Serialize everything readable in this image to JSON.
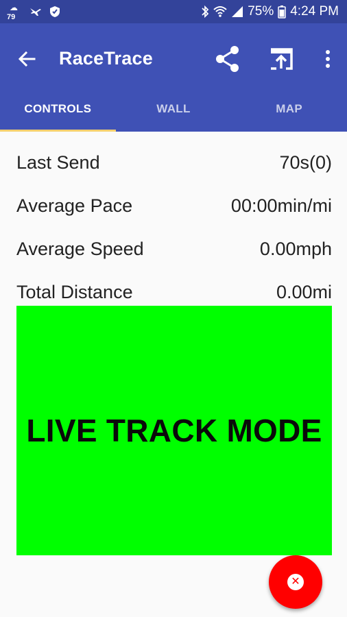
{
  "status_bar": {
    "temperature": "79",
    "battery": "75%",
    "time": "4:24 PM"
  },
  "toolbar": {
    "title": "RaceTrace",
    "icons": [
      "back-arrow-icon",
      "share-icon",
      "upload-icon",
      "more-vert-icon"
    ]
  },
  "tabs": [
    {
      "label": "CONTROLS",
      "active": true
    },
    {
      "label": "WALL",
      "active": false
    },
    {
      "label": "MAP",
      "active": false
    }
  ],
  "stats": [
    {
      "label": "Last Send",
      "value": "70s(0)"
    },
    {
      "label": "Average Pace",
      "value": "00:00min/mi"
    },
    {
      "label": "Average Speed",
      "value": "0.00mph"
    },
    {
      "label": "Total Distance",
      "value": "0.00mi"
    }
  ],
  "live_mode": {
    "text": "LIVE TRACK MODE",
    "color": "#00ff00"
  },
  "fab": {
    "icon": "close-icon",
    "color": "#ff0000"
  },
  "colors": {
    "status_bar": "#33439a",
    "app_bar": "#3f51b5",
    "tab_indicator": "#f4d06f"
  }
}
